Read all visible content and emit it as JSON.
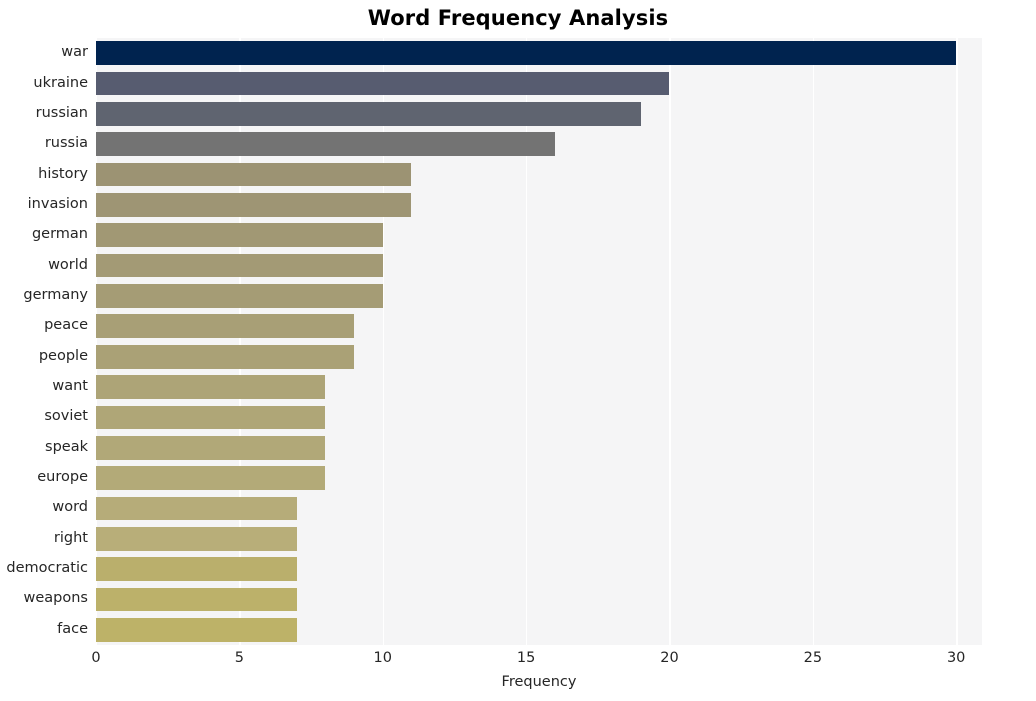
{
  "chart_data": {
    "type": "bar",
    "orientation": "horizontal",
    "title": "Word Frequency Analysis",
    "xlabel": "Frequency",
    "ylabel": "",
    "categories": [
      "war",
      "ukraine",
      "russian",
      "russia",
      "history",
      "invasion",
      "german",
      "world",
      "germany",
      "peace",
      "people",
      "want",
      "soviet",
      "speak",
      "europe",
      "word",
      "right",
      "democratic",
      "weapons",
      "face"
    ],
    "values": [
      30,
      20,
      19,
      16,
      11,
      11,
      10,
      10,
      10,
      9,
      9,
      8,
      8,
      8,
      8,
      7,
      7,
      7,
      7,
      7
    ],
    "xlim": [
      0,
      30.9
    ],
    "xticks": [
      0,
      5,
      10,
      15,
      20,
      25,
      30
    ],
    "xtick_labels": [
      "0",
      "5",
      "10",
      "15",
      "20",
      "25",
      "30"
    ],
    "grid": "vertical-only",
    "legend": "none",
    "bar_colors": [
      "#00234f",
      "#575c70",
      "#5f6470",
      "#737373",
      "#9c9373",
      "#9e9574",
      "#a19874",
      "#a39a75",
      "#a59c75",
      "#a89f76",
      "#aaa176",
      "#ada477",
      "#afa677",
      "#b1a878",
      "#b3aa78",
      "#b6ac79",
      "#b8ae79",
      "#baaf6c",
      "#bcb16a",
      "#bdb268"
    ],
    "plot_background": "#f5f5f6",
    "gridline_color": "#ffffff",
    "figure_background": "#ffffff",
    "text_color": "#262626"
  }
}
